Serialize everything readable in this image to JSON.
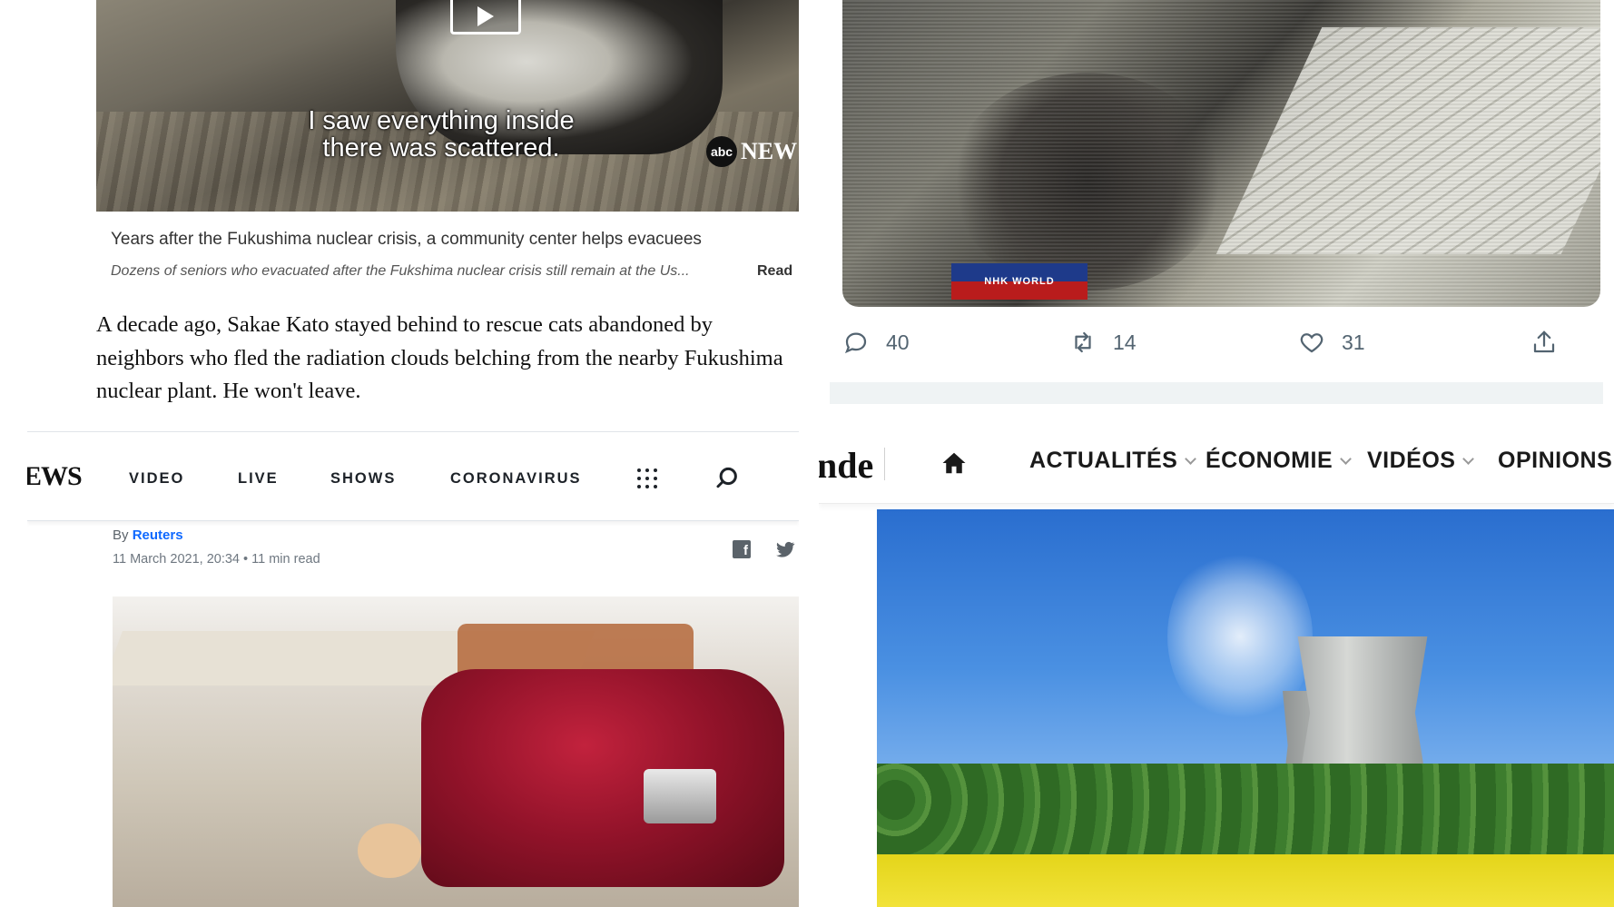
{
  "abc": {
    "video_caption_line1": "I saw everything inside",
    "video_caption_line2": "there was scattered.",
    "logo_circle": "abc",
    "logo_text": "NEW",
    "title": "Years after the Fukushima nuclear crisis, a community center helps evacuees",
    "description": "Dozens of seniors who evacuated after the Fukshima nuclear crisis still remain at the Us...",
    "read_label": "Read",
    "body": "A decade ago, Sakae Kato stayed behind to rescue cats abandoned by neighbors who fled the radiation clouds belching from the nearby Fukushima nuclear plant. He won't leave."
  },
  "twitter": {
    "media_badge": "NHK WORLD",
    "reply_count": "40",
    "retweet_count": "14",
    "like_count": "31",
    "icons": [
      "reply-icon",
      "retweet-icon",
      "like-icon",
      "share-icon"
    ]
  },
  "yahoo": {
    "logo": "EWS",
    "nav": [
      "VIDEO",
      "LIVE",
      "SHOWS",
      "CORONAVIRUS"
    ],
    "by_label": "By",
    "author": "Reuters",
    "date": "11 March 2021, 20:34",
    "read_time": "11 min read",
    "icons": [
      "apps-grid-icon",
      "search-icon",
      "facebook-icon",
      "twitter-icon"
    ]
  },
  "lemonde": {
    "logo": "nde",
    "nav": [
      "ACTUALITÉS",
      "ÉCONOMIE",
      "VIDÉOS",
      "OPINIONS"
    ],
    "icons": [
      "home-icon",
      "chevron-down-icon"
    ]
  },
  "colors": {
    "twitter_gray": "#536471",
    "yahoo_blue": "#0f69ff",
    "text_dark": "#111111"
  }
}
